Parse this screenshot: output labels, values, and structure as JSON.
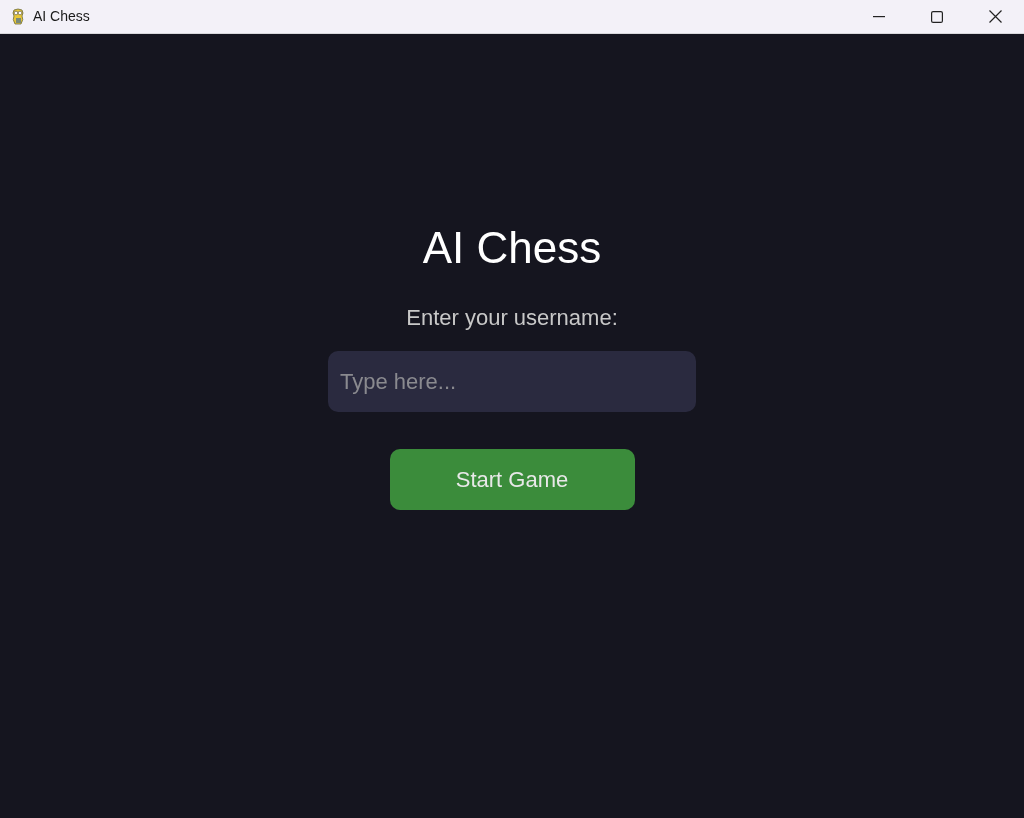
{
  "window": {
    "title": "AI Chess"
  },
  "heading": "AI Chess",
  "username_label": "Enter your username:",
  "username_field": {
    "placeholder": "Type here..."
  },
  "start_button": {
    "label": "Start Game"
  }
}
